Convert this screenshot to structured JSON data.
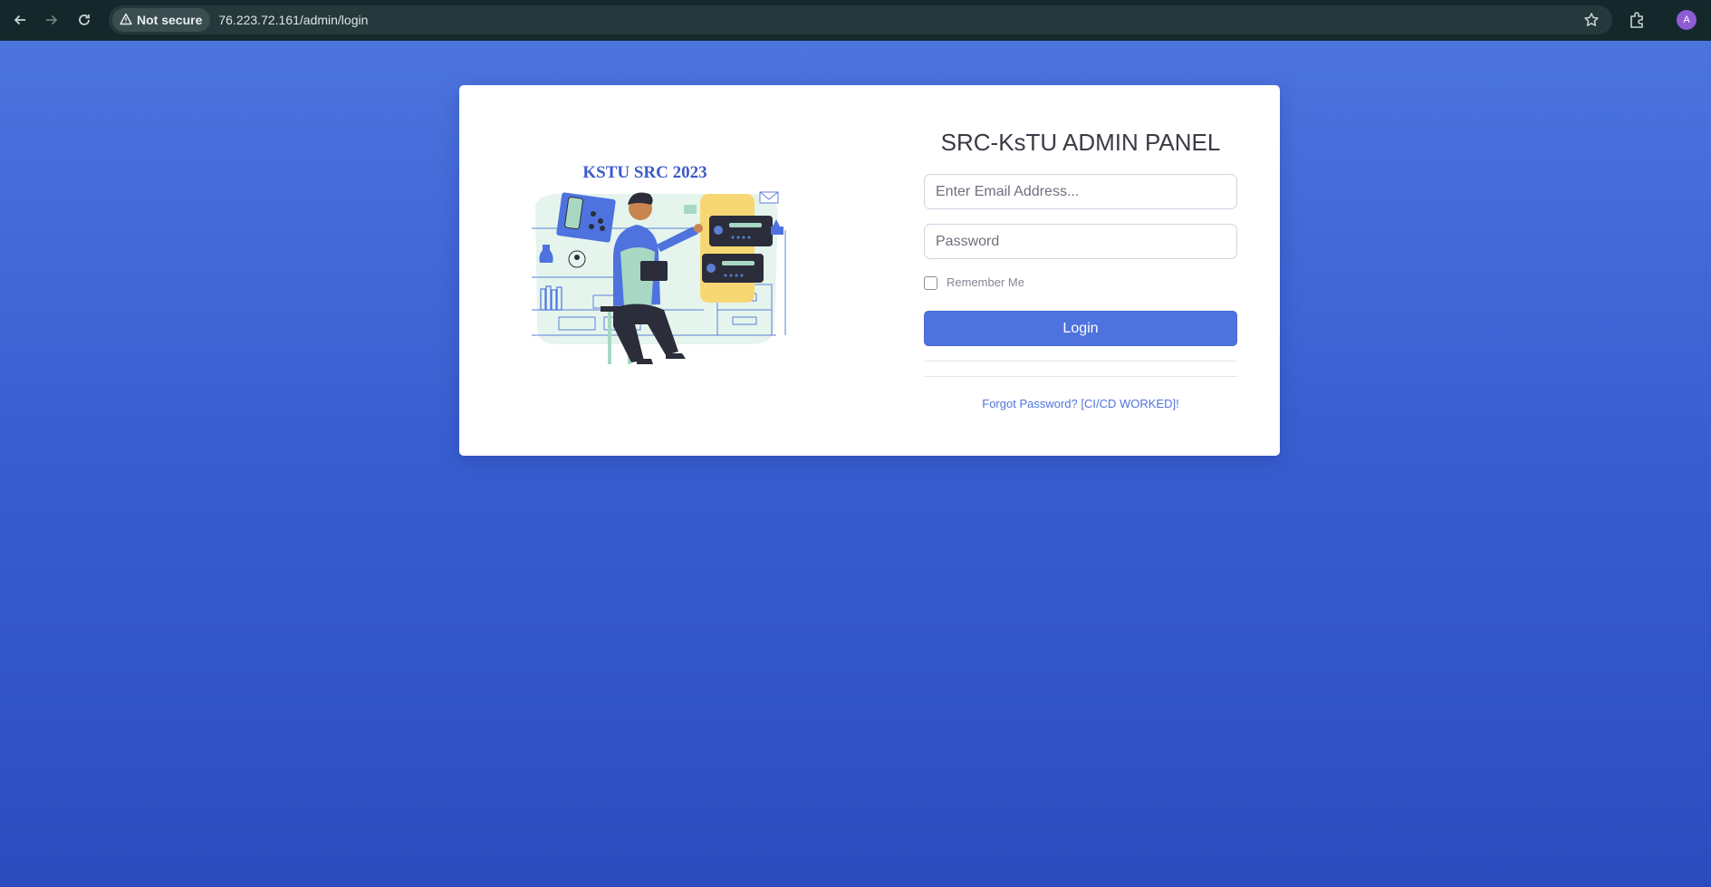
{
  "browser": {
    "security_label": "Not secure",
    "url": "76.223.72.161/admin/login",
    "profile_initial": "A",
    "icons": [
      "back-arrow-icon",
      "forward-arrow-icon",
      "reload-icon",
      "warning-icon",
      "star-icon",
      "extensions-icon"
    ]
  },
  "login": {
    "title": "SRC-KsTU ADMIN PANEL",
    "email_placeholder": "Enter Email Address...",
    "password_placeholder": "Password",
    "remember_label": "Remember Me",
    "login_label": "Login",
    "forgot_label": "Forgot Password? [CI/CD WORKED]!"
  },
  "illustration": {
    "caption": "KSTU SRC 2023"
  },
  "colors": {
    "primary": "#4e73df",
    "background_top": "#4c74de",
    "background_bottom": "#2b4cbe",
    "chrome": "#14282c"
  }
}
